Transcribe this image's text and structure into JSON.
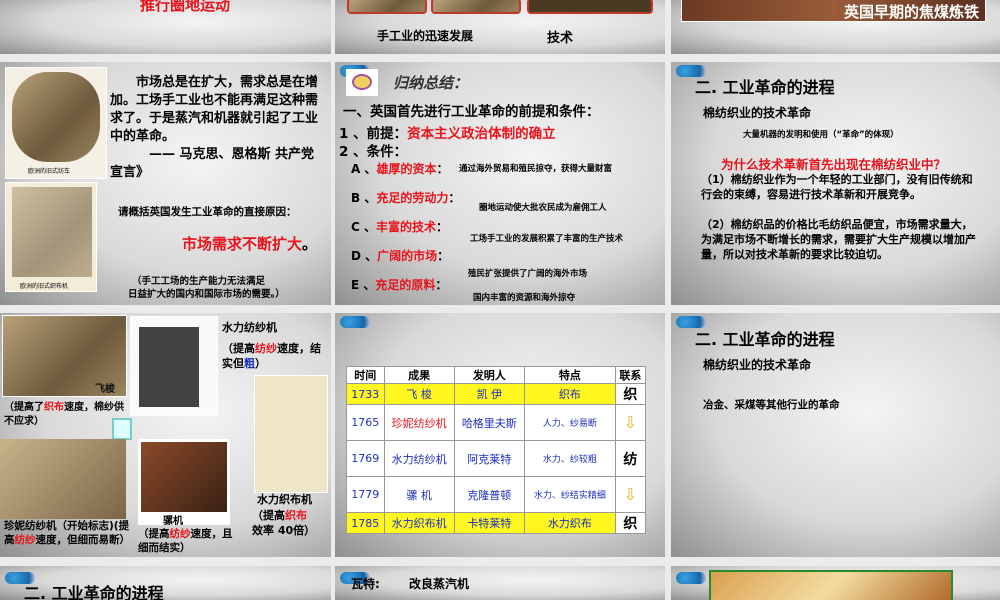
{
  "slides": [
    {
      "text": "推行圈地运动"
    },
    {
      "captions": [
        "手工业的迅速发展",
        "技术"
      ]
    },
    {
      "banner": "英国早期的焦煤炼铁"
    },
    {
      "quote": "市场总是在扩大，需求总是在增加。工场手工业也不能再满足这种需求了。于是蒸汽和机器就引起了工业中的革命。",
      "quote_source": "——  马克思、恩格斯  共产党宣言》",
      "img1": "欧洲的旧式纺车",
      "img2": "欧洲的旧式织布机",
      "question": "请概括英国发生工业革命的直接原因：",
      "answer": "市场需求不断扩大",
      "answer_end": "。",
      "note1": "（手工工场的生产能力无法满足",
      "note2": "日益扩大的国内和国际市场的需要。）"
    },
    {
      "heading": "归纳总结：",
      "title": "一、英国首先进行工业革命的前提和条件：",
      "premise_label": "1 、前提：",
      "premise": "资本主义政治体制的确立",
      "cond_label": "2 、条件：",
      "items": [
        {
          "k": "A 、",
          "label": "雄厚的资本",
          "desc": "通过海外贸易和殖民掠夺，获得大量财富"
        },
        {
          "k": "B 、",
          "label": "充足的劳动力",
          "desc": "圈地运动使大批农民成为雇佣工人"
        },
        {
          "k": "C 、",
          "label": "丰富的技术",
          "desc": "工场手工业的发展积累了丰富的生产技术"
        },
        {
          "k": "D 、",
          "label": "广阔的市场",
          "desc": "殖民扩张提供了广阔的海外市场"
        },
        {
          "k": "E 、",
          "label": "充足的原料",
          "desc": "国内丰富的资源和海外掠夺"
        }
      ]
    },
    {
      "title": "二. 工业革命的进程",
      "subtitle": "棉纺织业的技术革命",
      "note": "大量机器的发明和使用（“革命”的体现）",
      "question": "为什么技术革新首先出现在棉纺织业中？",
      "p1": "（1）棉纺织业作为一个年轻的工业部门，没有旧传统和行会的束缚，容易进行技术革新和开展竞争。",
      "p2": "（2）棉纺织品的价格比毛纺织品便宜，市场需求量大，为满足市场不断增长的需求，需要扩大生产规模以增加产量，所以对技术革新的要求比较迫切。"
    },
    {
      "water_frame": "水力纺纱机",
      "water_frame_desc": [
        "（提高",
        "纺纱",
        "速度，结实但",
        "粗",
        "）"
      ],
      "shuttle": "飞梭",
      "shuttle_desc": [
        "（提高了",
        "织布",
        "速度，棉纱供不应求）"
      ],
      "jenny_desc": [
        "珍妮纺纱机（开始标志)(提高",
        "纺纱",
        "速度，但细而易断）"
      ],
      "mule": "骡机",
      "mule_desc": [
        "（提高",
        "纺纱",
        "速度，且细而结实）"
      ],
      "loom": "水力织布机",
      "loom_desc": [
        "（提高",
        "织布",
        "效率 40倍）"
      ]
    },
    {
      "headers": [
        "时间",
        "成果",
        "发明人",
        "特点",
        "联系"
      ],
      "rows": [
        {
          "year": "1733",
          "result": "飞  梭",
          "inventor": "凯  伊",
          "feature": "织布",
          "link": "织"
        },
        {
          "year": "1765",
          "result": "珍妮纺纱机",
          "inventor": "哈格里夫斯",
          "feature": "人力、纱易断",
          "link": ""
        },
        {
          "year": "1769",
          "result": "水力纺纱机",
          "inventor": "阿克莱特",
          "feature": "水力、纱较粗",
          "link": "纺"
        },
        {
          "year": "1779",
          "result": "骡  机",
          "inventor": "克隆普顿",
          "feature": "水力、纱结实精细",
          "link": ""
        },
        {
          "year": "1785",
          "result": "水力织布机",
          "inventor": "卡特莱特",
          "feature": "水力织布",
          "link": "织"
        }
      ]
    },
    {
      "title": "二. 工业革命的进程",
      "subtitle": "棉纺织业的技术革命",
      "line": "冶金、采煤等其他行业的革命"
    },
    {
      "title": "二. 工业革命的进程"
    },
    {
      "text": "瓦特:       改良蒸汽机"
    },
    {}
  ]
}
